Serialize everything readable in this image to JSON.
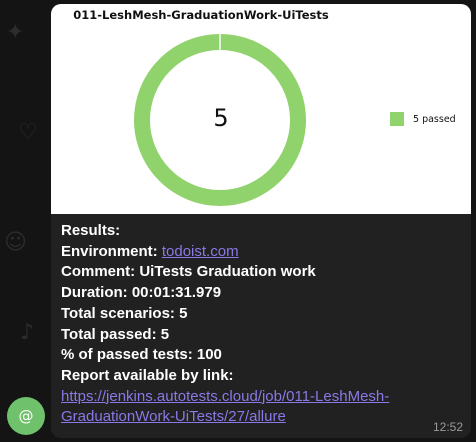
{
  "chat": {
    "avatar_icon": "at-icon",
    "avatar_glyph": "@",
    "message": {
      "chart_title": "011-LeshMesh-GraduationWork-UiTests",
      "timestamp": "12:52",
      "results_label": "Results:",
      "environment_label": "Environment:",
      "environment_link": "todoist.com",
      "comment_line": "Comment: UiTests Graduation work",
      "duration_line": "Duration: 00:01:31.979",
      "total_scenarios_line": "Total scenarios: 5",
      "total_passed_line": "Total passed: 5",
      "percent_line": "% of passed tests: 100",
      "report_label": "Report available by link:",
      "report_url_line1": "https://jenkins.autotests.cloud/job/011-LeshMesh-",
      "report_url_line2": "GraduationWork-UiTests/27/allure"
    }
  },
  "chart_data": {
    "type": "pie",
    "title": "011-LeshMesh-GraduationWork-UiTests",
    "center_label": "5",
    "slices": [
      {
        "label": "5 passed",
        "value": 5,
        "color": "#90d26c"
      }
    ],
    "legend_position": "right"
  }
}
